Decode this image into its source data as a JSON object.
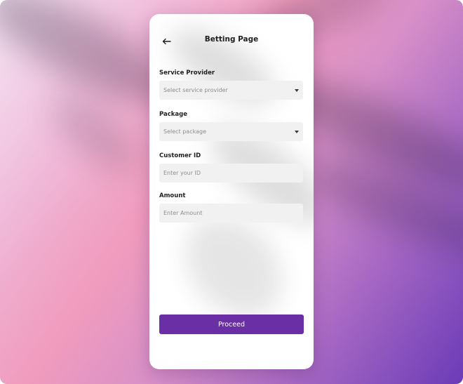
{
  "header": {
    "title": "Betting Page",
    "back_icon": "arrow-left-icon"
  },
  "form": {
    "service_provider": {
      "label": "Service Provider",
      "placeholder": "Select service provider",
      "icon": "caret-down-icon"
    },
    "package": {
      "label": "Package",
      "placeholder": "Select package",
      "icon": "caret-down-icon"
    },
    "customer_id": {
      "label": "Customer ID",
      "placeholder": "Enter your ID"
    },
    "amount": {
      "label": "Amount",
      "placeholder": "Enter Amount"
    }
  },
  "actions": {
    "proceed_label": "Proceed"
  },
  "colors": {
    "accent": "#6a2ea5",
    "field_background": "#f1f1f1",
    "card_background": "#ffffff"
  }
}
